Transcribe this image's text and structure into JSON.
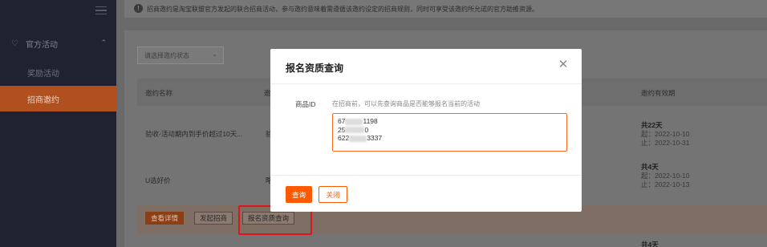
{
  "notice": {
    "text": "招商邀约是淘宝联盟官方发起的联合招商活动，参与邀约意味着需遵循该邀约设定的招商规则，同时可享受该邀约所允诺的官方助推资源。"
  },
  "sidebar": {
    "group_label": "官方活动",
    "items": [
      {
        "label": "奖励活动"
      },
      {
        "label": "招商邀约"
      }
    ]
  },
  "filter": {
    "placeholder": "请选择邀约状态"
  },
  "table": {
    "headers": [
      "邀约名称",
      "邀",
      "邀约有效期"
    ],
    "rows": [
      {
        "name": "验收-活动期内到手价超过10天...",
        "col2": "验",
        "total": "共22天",
        "start": "起：2022-10-10",
        "end": "止：2022-10-31"
      },
      {
        "name": "U选好价",
        "col2": "略",
        "total": "共4天",
        "start": "起：2022-10-10",
        "end": "止：2022-10-13"
      }
    ],
    "next_total": "共4天"
  },
  "actions": {
    "detail": "查看详情",
    "launch": "发起招商",
    "qualification": "报名资质查询"
  },
  "modal": {
    "title": "报名资质查询",
    "field_label": "商品ID",
    "hint": "在招商前，可以先查询商品是否能够报名当前的活动",
    "ids": [
      {
        "prefix": "67",
        "suffix": "1198"
      },
      {
        "prefix": "25",
        "suffix": "0"
      },
      {
        "prefix": "622",
        "suffix": "3337"
      }
    ],
    "query_button": "查询",
    "close_button": "关闭"
  },
  "colors": {
    "accent": "#ff5a00",
    "highlight": "#e0141b"
  }
}
